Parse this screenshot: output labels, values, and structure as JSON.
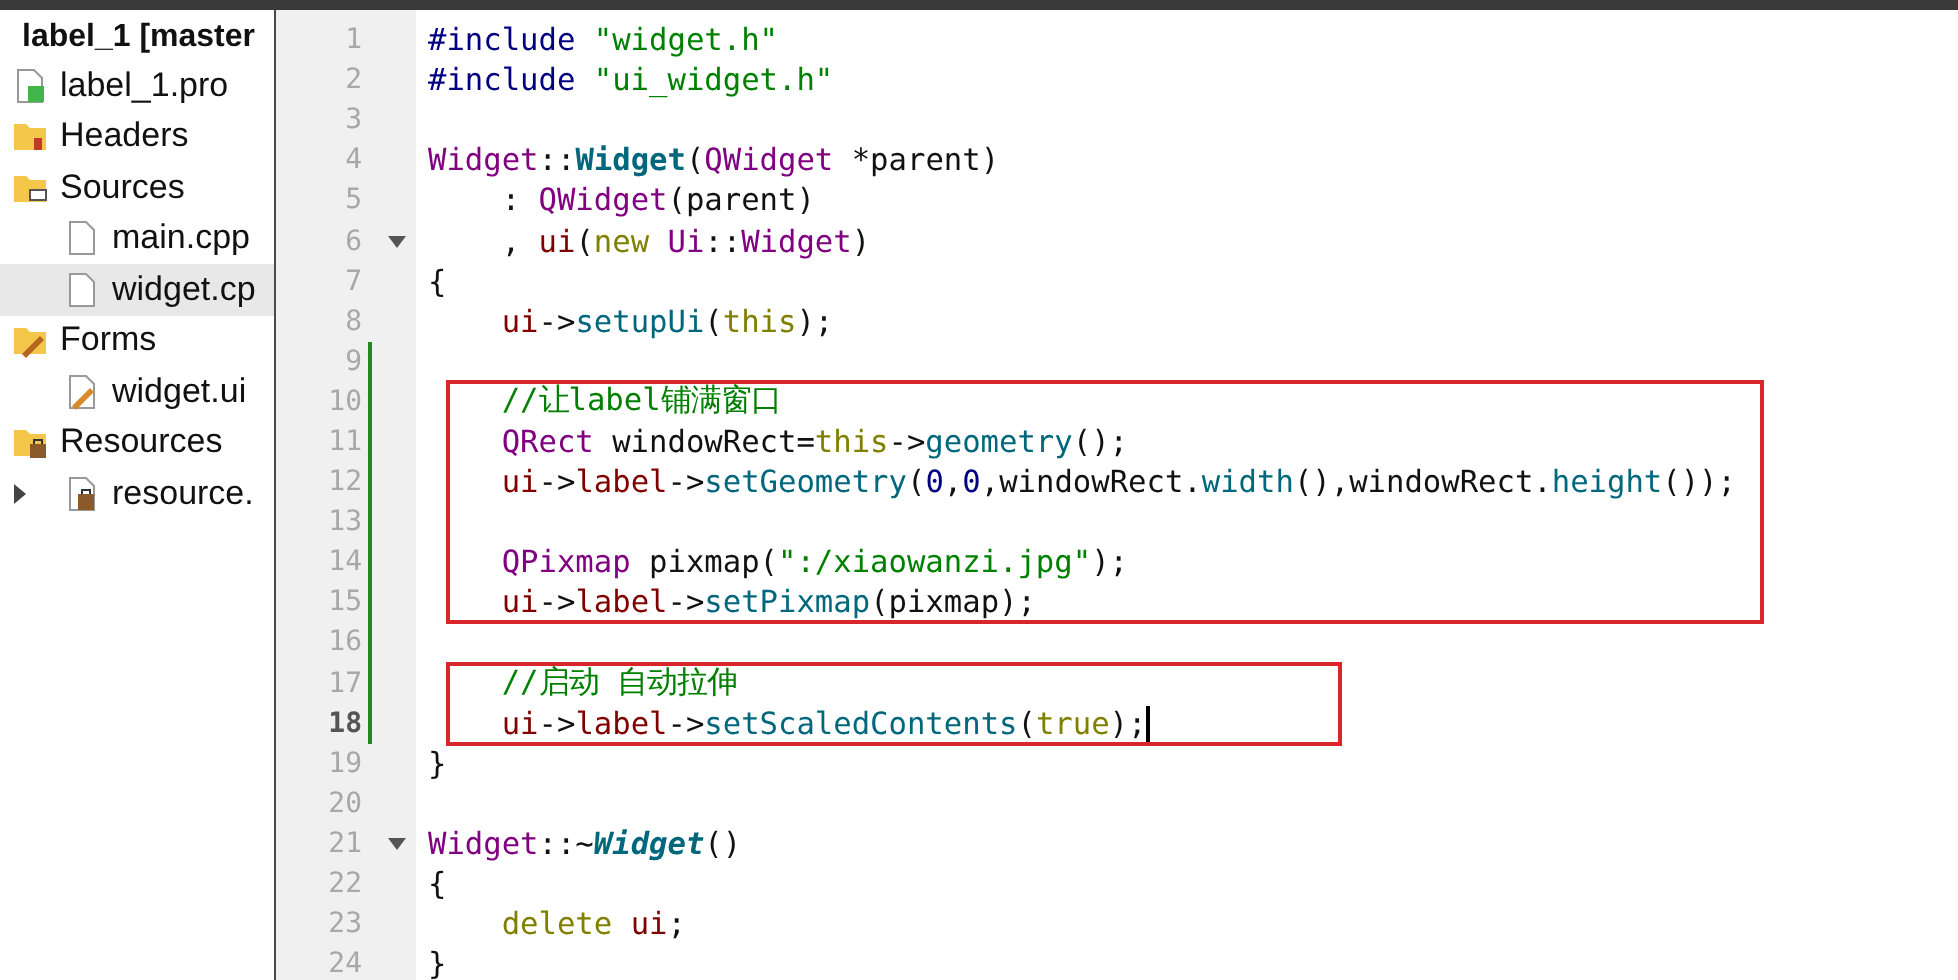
{
  "project_tree": {
    "label": "label_1 [master",
    "children": [
      {
        "label": "label_1.pro",
        "kind": "project-file",
        "selected": false
      },
      {
        "label": "Headers",
        "kind": "header-folder",
        "selected": false
      },
      {
        "label": "Sources",
        "kind": "source-folder",
        "selected": false,
        "children": [
          {
            "label": "main.cpp",
            "kind": "file",
            "selected": false
          },
          {
            "label": "widget.cp",
            "kind": "file",
            "selected": true
          }
        ]
      },
      {
        "label": "Forms",
        "kind": "form-folder",
        "selected": false,
        "children": [
          {
            "label": "widget.ui",
            "kind": "form-file",
            "selected": false
          }
        ]
      },
      {
        "label": "Resources",
        "kind": "resource-folder",
        "selected": false,
        "children": [
          {
            "label": "resource.",
            "kind": "resource-file",
            "selected": false,
            "expanded": false
          }
        ]
      }
    ]
  },
  "editor": {
    "lines": [
      {
        "number": "1",
        "tokens": [
          {
            "kind": "pre",
            "text": "#include "
          },
          {
            "kind": "str",
            "text": "\"widget.h\""
          }
        ]
      },
      {
        "number": "2",
        "tokens": [
          {
            "kind": "pre",
            "text": "#include "
          },
          {
            "kind": "str",
            "text": "\"ui_widget.h\""
          }
        ]
      },
      {
        "number": "3"
      },
      {
        "number": "4",
        "tokens": [
          {
            "kind": "type",
            "text": "Widget"
          },
          {
            "kind": "plain",
            "text": "::"
          },
          {
            "kind": "decl",
            "text": "Widget"
          },
          {
            "kind": "plain",
            "text": "("
          },
          {
            "kind": "type",
            "text": "QWidget"
          },
          {
            "kind": "plain",
            "text": " *parent)"
          }
        ]
      },
      {
        "number": "5",
        "tokens": [
          {
            "kind": "plain",
            "text": "    : "
          },
          {
            "kind": "type",
            "text": "QWidget"
          },
          {
            "kind": "plain",
            "text": "(parent)"
          }
        ]
      },
      {
        "number": "6",
        "fold": true,
        "tokens": [
          {
            "kind": "plain",
            "text": "    , "
          },
          {
            "kind": "field",
            "text": "ui"
          },
          {
            "kind": "plain",
            "text": "("
          },
          {
            "kind": "kw",
            "text": "new "
          },
          {
            "kind": "type",
            "text": "Ui"
          },
          {
            "kind": "plain",
            "text": "::"
          },
          {
            "kind": "type",
            "text": "Widget"
          },
          {
            "kind": "plain",
            "text": ")"
          }
        ]
      },
      {
        "number": "7",
        "tokens": [
          {
            "kind": "plain",
            "text": "{"
          }
        ]
      },
      {
        "number": "8",
        "tokens": [
          {
            "kind": "field",
            "text": "    ui"
          },
          {
            "kind": "plain",
            "text": "->"
          },
          {
            "kind": "func",
            "text": "setupUi"
          },
          {
            "kind": "plain",
            "text": "("
          },
          {
            "kind": "kw",
            "text": "this"
          },
          {
            "kind": "plain",
            "text": ");"
          }
        ]
      },
      {
        "number": "9",
        "modified": true
      },
      {
        "number": "10",
        "modified": true,
        "boxed": true,
        "tokens": [
          {
            "kind": "comment",
            "text": "    //让label铺满窗口"
          }
        ]
      },
      {
        "number": "11",
        "modified": true,
        "boxed": true,
        "tokens": [
          {
            "kind": "type",
            "text": "    QRect"
          },
          {
            "kind": "plain",
            "text": " windowRect="
          },
          {
            "kind": "kw",
            "text": "this"
          },
          {
            "kind": "plain",
            "text": "->"
          },
          {
            "kind": "func",
            "text": "geometry"
          },
          {
            "kind": "plain",
            "text": "();"
          }
        ]
      },
      {
        "number": "12",
        "modified": true,
        "boxed": true,
        "tokens": [
          {
            "kind": "field",
            "text": "    ui"
          },
          {
            "kind": "plain",
            "text": "->"
          },
          {
            "kind": "field",
            "text": "label"
          },
          {
            "kind": "plain",
            "text": "->"
          },
          {
            "kind": "func",
            "text": "setGeometry"
          },
          {
            "kind": "plain",
            "text": "("
          },
          {
            "kind": "num",
            "text": "0"
          },
          {
            "kind": "plain",
            "text": ","
          },
          {
            "kind": "num",
            "text": "0"
          },
          {
            "kind": "plain",
            "text": ",windowRect."
          },
          {
            "kind": "func",
            "text": "width"
          },
          {
            "kind": "plain",
            "text": "(),windowRect."
          },
          {
            "kind": "func",
            "text": "height"
          },
          {
            "kind": "plain",
            "text": "());"
          }
        ]
      },
      {
        "number": "13",
        "modified": true,
        "boxed": true
      },
      {
        "number": "14",
        "modified": true,
        "boxed": true,
        "tokens": [
          {
            "kind": "type",
            "text": "    QPixmap"
          },
          {
            "kind": "plain",
            "text": " pixmap("
          },
          {
            "kind": "str",
            "text": "\":/xiaowanzi.jpg\""
          },
          {
            "kind": "plain",
            "text": ");"
          }
        ]
      },
      {
        "number": "15",
        "modified": true,
        "boxed": true,
        "tokens": [
          {
            "kind": "field",
            "text": "    ui"
          },
          {
            "kind": "plain",
            "text": "->"
          },
          {
            "kind": "field",
            "text": "label"
          },
          {
            "kind": "plain",
            "text": "->"
          },
          {
            "kind": "func",
            "text": "setPixmap"
          },
          {
            "kind": "plain",
            "text": "(pixmap);"
          }
        ]
      },
      {
        "number": "16",
        "modified": true
      },
      {
        "number": "17",
        "modified": true,
        "boxed": true,
        "tokens": [
          {
            "kind": "comment",
            "text": "    //启动 自动拉伸"
          }
        ]
      },
      {
        "number": "18",
        "modified": true,
        "boxed": true,
        "current": true,
        "tokens": [
          {
            "kind": "field",
            "text": "    ui"
          },
          {
            "kind": "plain",
            "text": "->"
          },
          {
            "kind": "field",
            "text": "label"
          },
          {
            "kind": "plain",
            "text": "->"
          },
          {
            "kind": "func",
            "text": "setScaledContents"
          },
          {
            "kind": "plain",
            "text": "("
          },
          {
            "kind": "kw",
            "text": "true"
          },
          {
            "kind": "plain",
            "text": ");"
          }
        ]
      },
      {
        "number": "19",
        "tokens": [
          {
            "kind": "plain",
            "text": "}"
          }
        ]
      },
      {
        "number": "20"
      },
      {
        "number": "21",
        "fold": true,
        "tokens": [
          {
            "kind": "type",
            "text": "Widget"
          },
          {
            "kind": "plain",
            "text": "::~"
          },
          {
            "kind": "dtor",
            "text": "Widget"
          },
          {
            "kind": "plain",
            "text": "()"
          }
        ]
      },
      {
        "number": "22",
        "tokens": [
          {
            "kind": "plain",
            "text": "{"
          }
        ]
      },
      {
        "number": "23",
        "tokens": [
          {
            "kind": "kw",
            "text": "    delete "
          },
          {
            "kind": "field",
            "text": "ui"
          },
          {
            "kind": "plain",
            "text": ";"
          }
        ]
      },
      {
        "number": "24",
        "tokens": [
          {
            "kind": "plain",
            "text": "}"
          }
        ]
      }
    ]
  }
}
